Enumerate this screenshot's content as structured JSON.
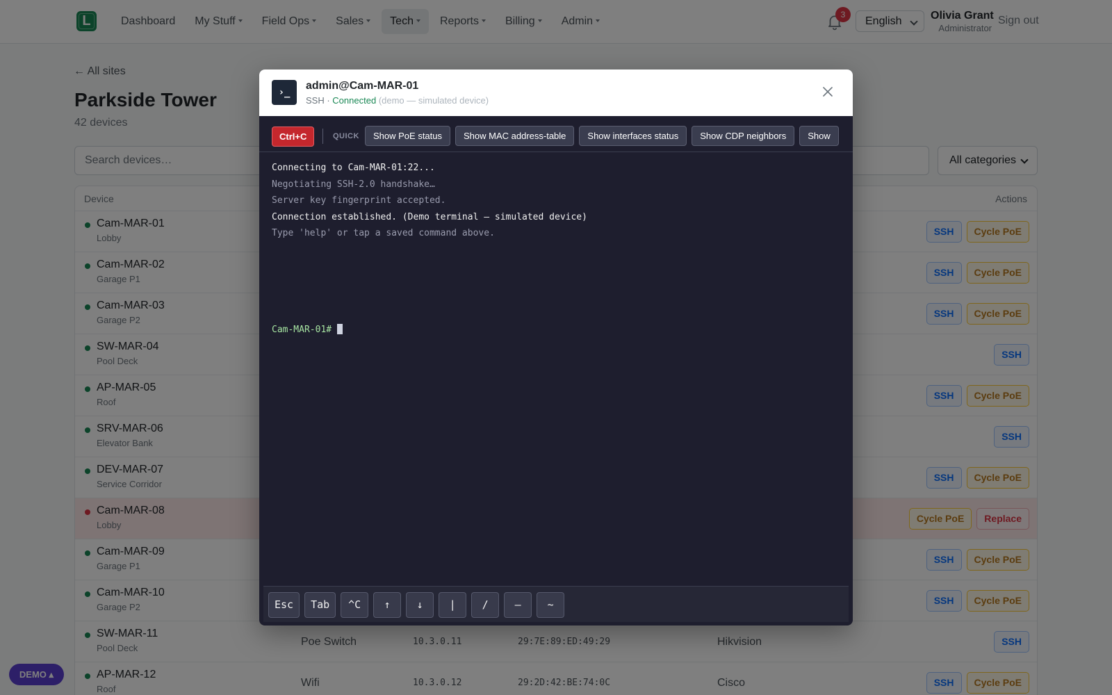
{
  "navbar": {
    "logo_letter": "L",
    "menu": [
      {
        "label": "Dashboard",
        "dropdown": false
      },
      {
        "label": "My Stuff",
        "dropdown": true
      },
      {
        "label": "Field Ops",
        "dropdown": true
      },
      {
        "label": "Sales",
        "dropdown": true
      },
      {
        "label": "Tech",
        "dropdown": true,
        "active": true
      },
      {
        "label": "Reports",
        "dropdown": true
      },
      {
        "label": "Billing",
        "dropdown": true
      },
      {
        "label": "Admin",
        "dropdown": true
      }
    ],
    "notification_count": "3",
    "language": "English",
    "user_name": "Olivia Grant",
    "user_role": "Administrator",
    "signout_label": "Sign out"
  },
  "page": {
    "back_label": "← All sites",
    "title": "Parkside Tower",
    "device_count": "42 devices",
    "search_placeholder": "Search devices…",
    "category_filter": "All categories",
    "table": {
      "col_device": "Device",
      "col_actions": "Actions",
      "rows": [
        {
          "name": "Cam-MAR-01",
          "location": "Lobby",
          "status": "online",
          "type": "",
          "ip": "",
          "mac": "",
          "vendor": "",
          "actions": [
            "SSH",
            "Cycle PoE"
          ]
        },
        {
          "name": "Cam-MAR-02",
          "location": "Garage P1",
          "status": "online",
          "type": "",
          "ip": "",
          "mac": "",
          "vendor": "",
          "actions": [
            "SSH",
            "Cycle PoE"
          ]
        },
        {
          "name": "Cam-MAR-03",
          "location": "Garage P2",
          "status": "online",
          "type": "",
          "ip": "",
          "mac": "",
          "vendor": "",
          "actions": [
            "SSH",
            "Cycle PoE"
          ]
        },
        {
          "name": "SW-MAR-04",
          "location": "Pool Deck",
          "status": "online",
          "type": "",
          "ip": "",
          "mac": "",
          "vendor": "",
          "actions": [
            "SSH"
          ]
        },
        {
          "name": "AP-MAR-05",
          "location": "Roof",
          "status": "online",
          "type": "",
          "ip": "",
          "mac": "",
          "vendor": "",
          "actions": [
            "SSH",
            "Cycle PoE"
          ]
        },
        {
          "name": "SRV-MAR-06",
          "location": "Elevator Bank",
          "status": "online",
          "type": "",
          "ip": "",
          "mac": "",
          "vendor": "",
          "actions": [
            "SSH"
          ]
        },
        {
          "name": "DEV-MAR-07",
          "location": "Service Corridor",
          "status": "online",
          "type": "",
          "ip": "",
          "mac": "",
          "vendor": "",
          "actions": [
            "SSH",
            "Cycle PoE"
          ]
        },
        {
          "name": "Cam-MAR-08",
          "location": "Lobby",
          "status": "offline",
          "type": "",
          "ip": "",
          "mac": "",
          "vendor": "",
          "actions": [
            "Cycle PoE",
            "Replace"
          ]
        },
        {
          "name": "Cam-MAR-09",
          "location": "Garage P1",
          "status": "online",
          "type": "",
          "ip": "",
          "mac": "",
          "vendor": "",
          "actions": [
            "SSH",
            "Cycle PoE"
          ]
        },
        {
          "name": "Cam-MAR-10",
          "location": "Garage P2",
          "status": "online",
          "type": "",
          "ip": "",
          "mac": "",
          "vendor": "",
          "actions": [
            "SSH",
            "Cycle PoE"
          ]
        },
        {
          "name": "SW-MAR-11",
          "location": "Pool Deck",
          "status": "online",
          "type": "Poe Switch",
          "ip": "10.3.0.11",
          "mac": "29:7E:89:ED:49:29",
          "vendor": "Hikvision",
          "actions": [
            "SSH"
          ]
        },
        {
          "name": "AP-MAR-12",
          "location": "Roof",
          "status": "online",
          "type": "Wifi",
          "ip": "10.3.0.12",
          "mac": "29:2D:42:BE:74:0C",
          "vendor": "Cisco",
          "actions": [
            "SSH",
            "Cycle PoE"
          ]
        }
      ]
    }
  },
  "demo_badge": "DEMO ▴",
  "modal": {
    "icon_text": "›_",
    "title": "admin@Cam-MAR-01",
    "protocol": "SSH ·",
    "state": "Connected",
    "note": "(demo — simulated device)",
    "ctrl_c": "Ctrl+C",
    "quick_label": "QUICK",
    "quick_commands": [
      "Show PoE status",
      "Show MAC address-table",
      "Show interfaces status",
      "Show CDP neighbors",
      "Show"
    ],
    "terminal_lines": [
      {
        "text": "Connecting to Cam-MAR-01:22...",
        "style": "bright"
      },
      {
        "text": "Negotiating SSH-2.0 handshake…",
        "style": "dim"
      },
      {
        "text": "Server key fingerprint accepted.",
        "style": "dim"
      },
      {
        "text": "Connection established. (Demo terminal — simulated device)",
        "style": "bright"
      },
      {
        "text": "Type 'help' or tap a saved command above.",
        "style": "dim"
      }
    ],
    "prompt": "Cam-MAR-01#",
    "keys": [
      "Esc",
      "Tab",
      "^C",
      "↑",
      "↓",
      "|",
      "/",
      "–",
      "~"
    ]
  },
  "colors": {
    "accent": "#198754",
    "danger": "#dc3545",
    "terminal_bg": "#1e1e2e",
    "prompt": "#a6e3a1"
  }
}
